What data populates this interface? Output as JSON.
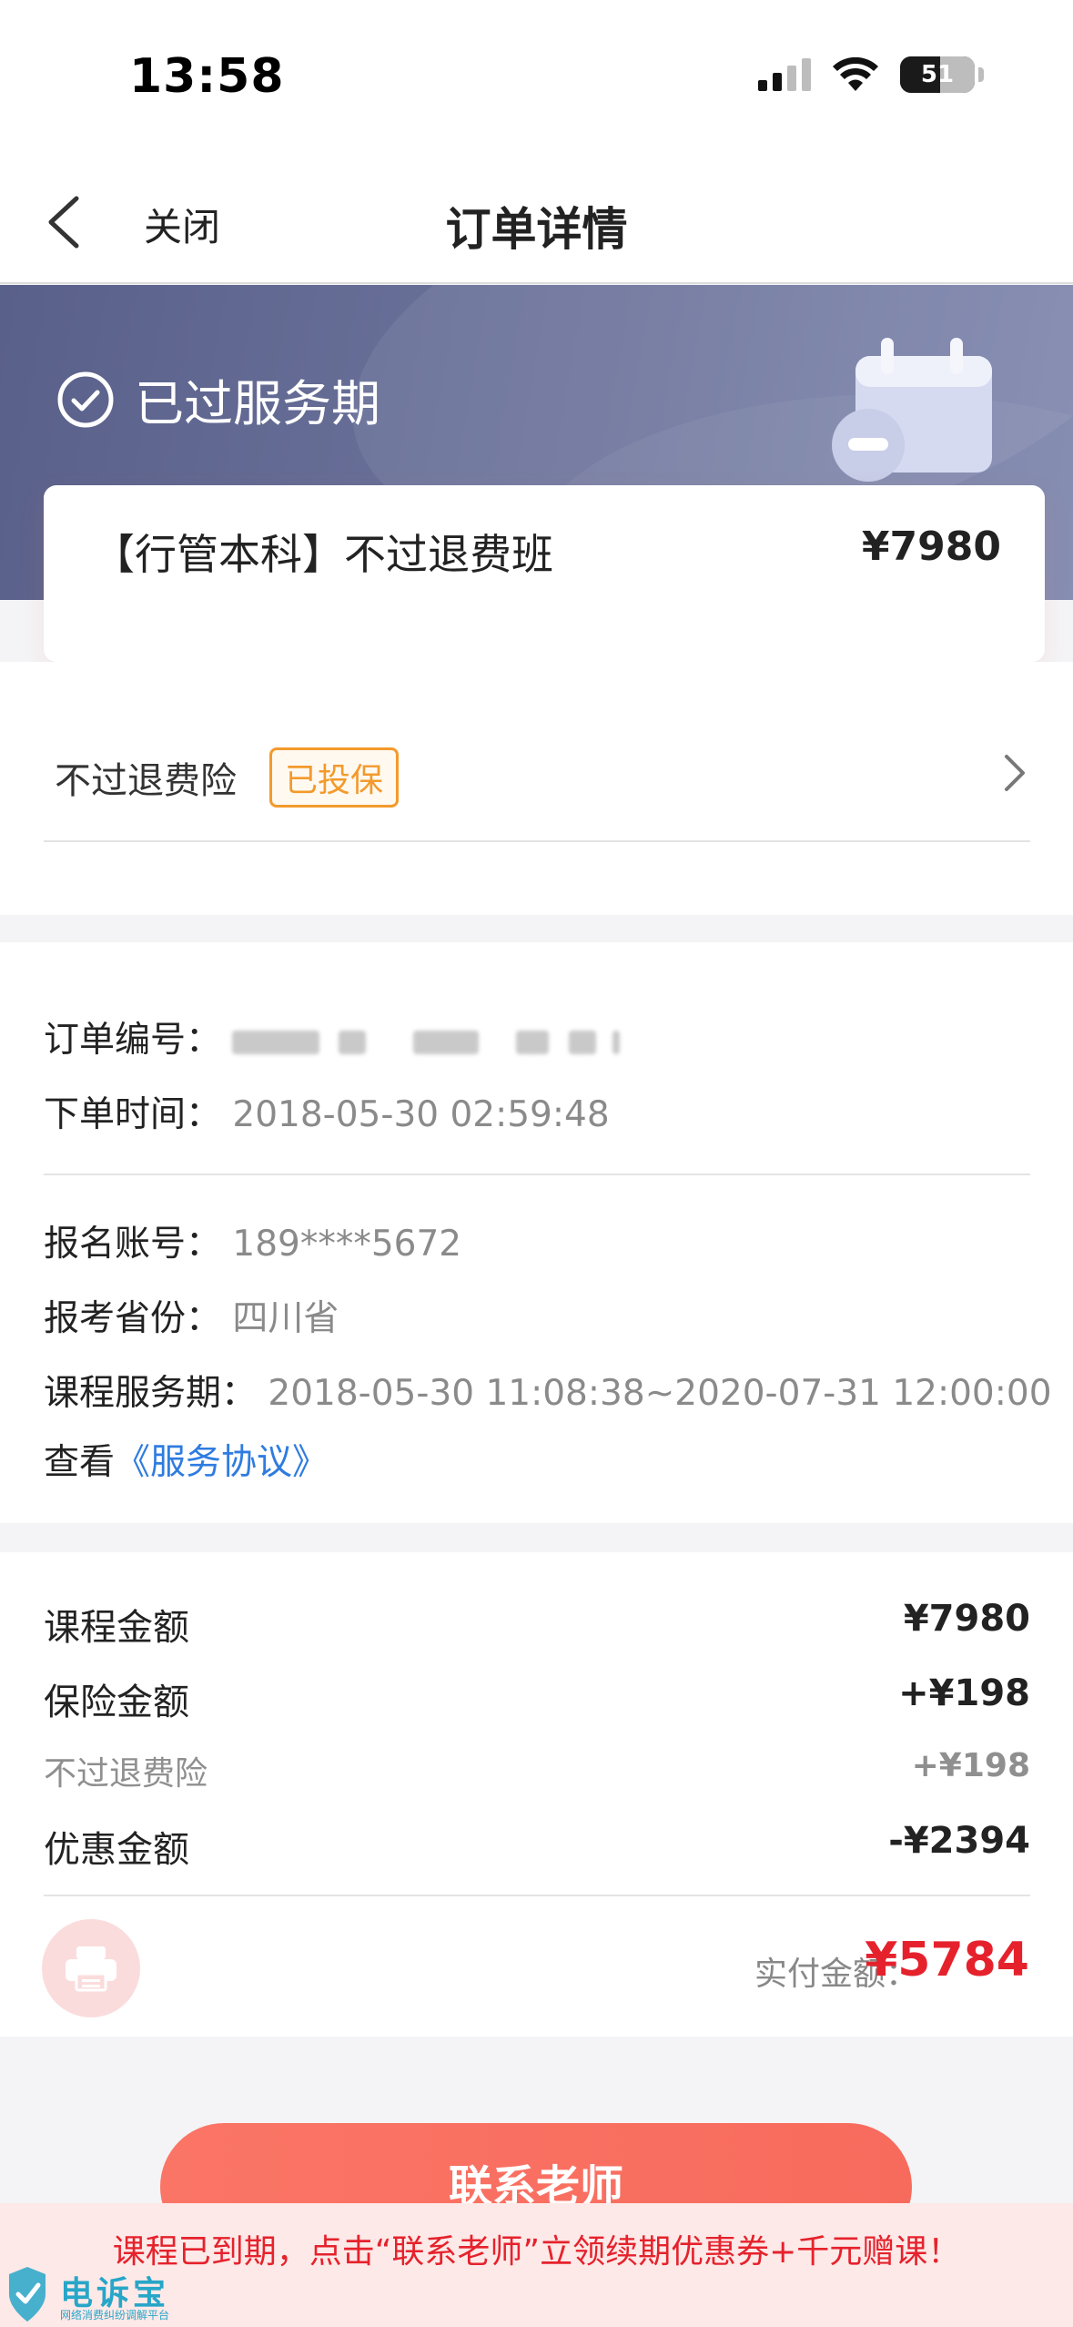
{
  "status_bar": {
    "time": "13:58",
    "battery": "51"
  },
  "nav": {
    "close_label": "关闭",
    "title": "订单详情"
  },
  "banner": {
    "status_text": "已过服务期"
  },
  "course": {
    "name": "【行管本科】不过退费班",
    "price": "¥7980"
  },
  "insurance": {
    "label": "不过退费险",
    "badge": "已投保"
  },
  "order_info": {
    "order_no_label": "订单编号：",
    "order_time_label": "下单时间：",
    "order_time": "2018-05-30 02:59:48",
    "account_label": "报名账号：",
    "account": "189****5672",
    "province_label": "报考省份：",
    "province": "四川省",
    "service_period_label": "课程服务期：",
    "service_period": "2018-05-30 11:08:38~2020-07-31 12:00:00",
    "view_prefix": "查看",
    "agreement_link": "《服务协议》"
  },
  "amounts": {
    "course_label": "课程金额",
    "course_value": "¥7980",
    "insurance_label": "保险金额",
    "insurance_value": "+¥198",
    "insurance_sub_label": "不过退费险",
    "insurance_sub_value": "+¥198",
    "discount_label": "优惠金额",
    "discount_value": "-¥2394",
    "total_label": "实付金额：",
    "total_value": "¥5784"
  },
  "actions": {
    "contact_button": "联系老师"
  },
  "notice": {
    "text": "课程已到期，点击“联系老师”立领续期优惠券+千元赠课！"
  },
  "watermark": {
    "name": "电诉宝",
    "sub": "网络消费纠纷调解平台"
  },
  "colors": {
    "accent_red": "#e5222c",
    "badge_orange": "#f39a2c",
    "link_blue": "#2f7ce0",
    "banner": "#5f668f"
  }
}
